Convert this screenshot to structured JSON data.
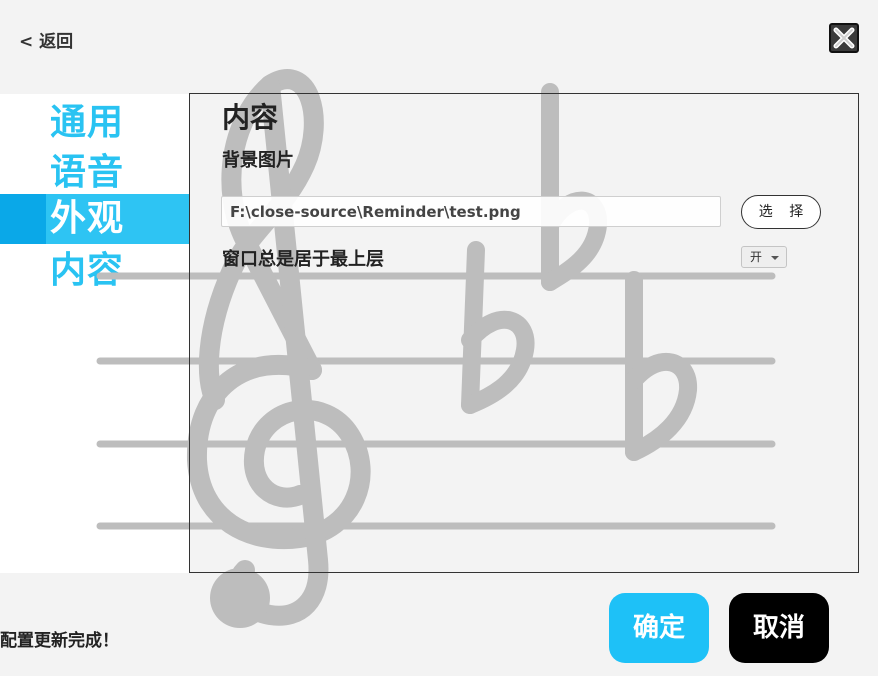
{
  "header": {
    "back_label": "< 返回",
    "close_icon": "close-icon"
  },
  "sidebar": {
    "items": [
      {
        "label": "通用",
        "active": false
      },
      {
        "label": "语音",
        "active": false
      },
      {
        "label": "外观",
        "active": true
      },
      {
        "label": "内容",
        "active": false
      }
    ]
  },
  "panel": {
    "title": "内容",
    "background_image_label": "背景图片",
    "background_image_path": "F:\\close-source\\Reminder\\test.png",
    "choose_button": "选 择",
    "always_on_top_label": "窗口总是居于最上层",
    "always_on_top_value": "开"
  },
  "footer": {
    "status": "配置更新完成！",
    "ok_button": "确定",
    "cancel_button": "取消"
  },
  "colors": {
    "accent": "#29c3f2",
    "active_bg": "#2ec4f3",
    "ok_bg": "#1ec1f7",
    "cancel_bg": "#000000"
  }
}
